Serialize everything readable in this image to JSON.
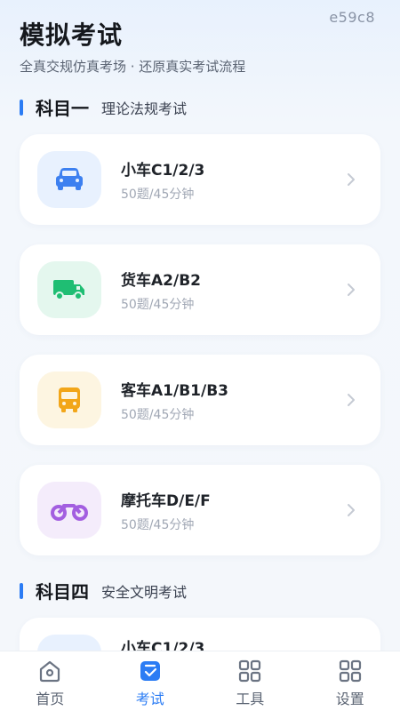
{
  "watermark": "e59c8",
  "header": {
    "title": "模拟考试",
    "subtitle": "全真交规仿真考场 · 还原真实考试流程"
  },
  "colors": {
    "accent": "#2b7cf4",
    "car_bg": "#e8f1fe",
    "car_fg": "#3d80f0",
    "truck_bg": "#e4f7ee",
    "truck_fg": "#1fbe73",
    "bus_bg": "#fdf5e1",
    "bus_fg": "#f2a619",
    "moto_bg": "#f4ecfb",
    "moto_fg": "#a35fe0"
  },
  "sections": [
    {
      "title": "科目一",
      "desc": "理论法规考试",
      "cards": [
        {
          "icon": "car-icon",
          "title": "小车C1/2/3",
          "sub": "50题/45分钟"
        },
        {
          "icon": "truck-icon",
          "title": "货车A2/B2",
          "sub": "50题/45分钟"
        },
        {
          "icon": "bus-icon",
          "title": "客车A1/B1/B3",
          "sub": "50题/45分钟"
        },
        {
          "icon": "motorcycle-icon",
          "title": "摩托车D/E/F",
          "sub": "50题/45分钟"
        }
      ]
    },
    {
      "title": "科目四",
      "desc": "安全文明考试",
      "cards": [
        {
          "icon": "car-icon",
          "title": "小车C1/2/3"
        }
      ]
    }
  ],
  "tabbar": [
    {
      "label": "首页",
      "icon": "home-icon",
      "active": false
    },
    {
      "label": "考试",
      "icon": "exam-icon",
      "active": true
    },
    {
      "label": "工具",
      "icon": "grid-icon",
      "active": false
    },
    {
      "label": "设置",
      "icon": "grid-icon",
      "active": false
    }
  ]
}
